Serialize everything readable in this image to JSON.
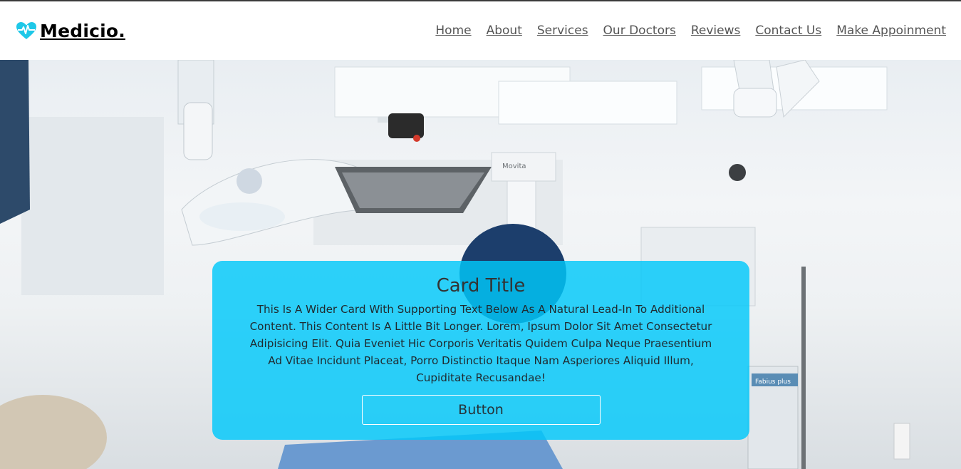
{
  "header": {
    "brand": "Medicio.",
    "nav": [
      "Home",
      "About",
      "Services",
      "Our Doctors",
      "Reviews",
      "Contact Us",
      "Make Appoinment"
    ]
  },
  "hero": {
    "equipment_labels": [
      "Movita",
      "Fabius plus"
    ]
  },
  "card": {
    "title": "Card Title",
    "text": "This Is A Wider Card With Supporting Text Below As A Natural Lead-In To Additional Content. This Content Is A Little Bit Longer. Lorem, Ipsum Dolor Sit Amet Consectetur Adipisicing Elit. Quia Eveniet Hic Corporis Veritatis Quidem Culpa Neque Praesentium Ad Vitae Incidunt Placeat, Porro Distinctio Itaque Nam Asperiores Aliquid Illum, Cupiditate Recusandae!",
    "button": "Button"
  },
  "colors": {
    "brand_icon": "#1ec8e8",
    "card_bg": "#00c8fa",
    "nav_text": "#555555"
  },
  "icons": {
    "brand": "heart-pulse-icon"
  }
}
